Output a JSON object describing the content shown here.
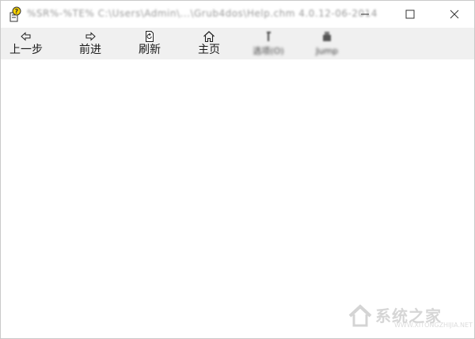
{
  "window": {
    "title": "%SR%-%TE%  C:\\Users\\Admin\\...\\Grub4dos\\Help.chm  4.0.12-06-2014",
    "controls": {
      "minimize_icon": "minimize-icon",
      "maximize_icon": "maximize-icon",
      "close_icon": "close-icon"
    }
  },
  "toolbar": {
    "back_label": "上一步",
    "forward_label": "前进",
    "refresh_label": "刷新",
    "home_label": "主页",
    "options_label": "选项(O)",
    "extra_label": "Jump"
  },
  "watermark": {
    "text": "系统之家",
    "url": "WWW.XITONGZHIJIA.NET"
  },
  "colors": {
    "toolbar_bg": "#f0f0f0",
    "content_bg": "#ffffff",
    "watermark": "#d6d6d6"
  }
}
